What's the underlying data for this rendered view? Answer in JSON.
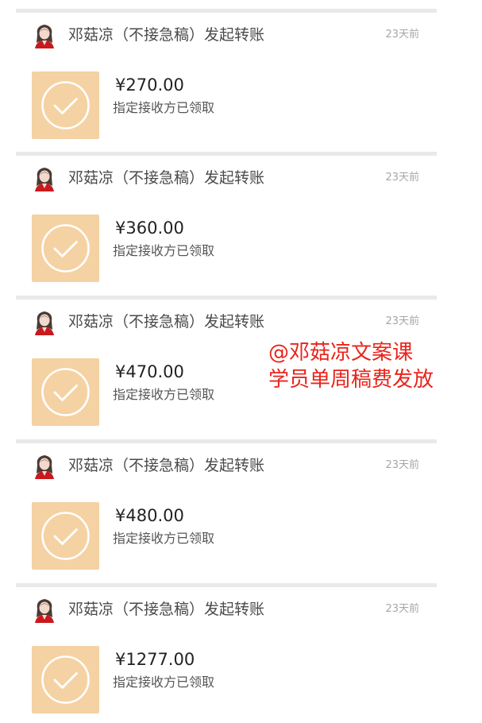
{
  "transfers": [
    {
      "sender": "邓菇凉（不接急稿）发起转账",
      "time": "23天前",
      "amount": "¥270.00",
      "status": "指定接收方已领取"
    },
    {
      "sender": "邓菇凉（不接急稿）发起转账",
      "time": "23天前",
      "amount": "¥360.00",
      "status": "指定接收方已领取"
    },
    {
      "sender": "邓菇凉（不接急稿）发起转账",
      "time": "23天前",
      "amount": "¥470.00",
      "status": "指定接收方已领取"
    },
    {
      "sender": "邓菇凉（不接急稿）发起转账",
      "time": "23天前",
      "amount": "¥480.00",
      "status": "指定接收方已领取"
    },
    {
      "sender": "邓菇凉（不接急稿）发起转账",
      "time": "23天前",
      "amount": "¥1277.00",
      "status": "指定接收方已领取"
    }
  ],
  "overlay": {
    "line1": "@邓菇凉文案课",
    "line2": "学员单周稿费发放"
  },
  "colors": {
    "tile": "#f5d2a3",
    "overlay_text": "#e8241b",
    "divider": "#e9e9e9"
  },
  "icons": {
    "avatar": "avatar-girl-icon",
    "received": "check-circle-icon"
  }
}
